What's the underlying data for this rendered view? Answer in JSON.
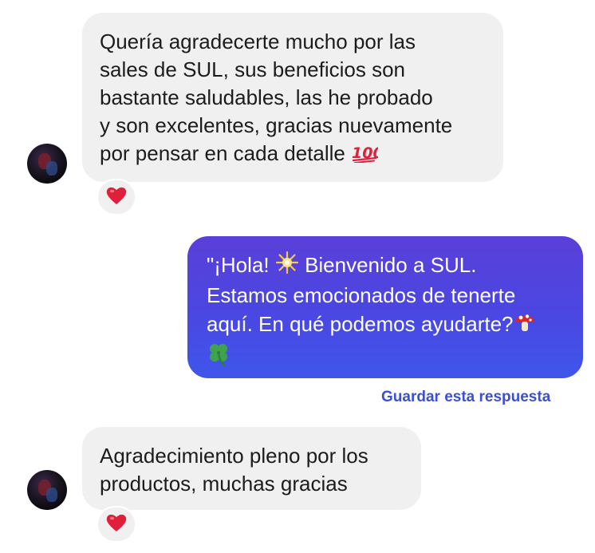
{
  "conversation": {
    "messages": [
      {
        "direction": "incoming",
        "lines": [
          "Quería agradecerte mucho por las",
          "sales de SUL, sus beneficios son",
          "bastante saludables, las he probado",
          "y son excelentes, gracias nuevamente",
          "por pensar en cada detalle"
        ],
        "trailing_emoji": "hundred-points-icon",
        "reaction": "heart-icon"
      },
      {
        "direction": "outgoing",
        "lines": [
          "\"¡Hola!",
          "Bienvenido a SUL.",
          "Estamos emocionados de tenerte",
          "aquí. En qué podemos ayudarte?"
        ],
        "emojis": [
          "sparkle-star-icon",
          "mushroom-icon",
          "four-leaf-clover-icon"
        ]
      },
      {
        "direction": "incoming",
        "lines": [
          "Agradecimiento pleno por los",
          "productos, muchas gracias"
        ],
        "reaction": "heart-icon"
      }
    ],
    "save_reply_label": "Guardar esta respuesta"
  },
  "colors": {
    "incoming_bubble": "#f0f0f0",
    "outgoing_bubble_top": "#5a3fd8",
    "outgoing_bubble_bottom": "#3f56ea",
    "save_link": "#3b4fd6",
    "heart": "#e0203a"
  }
}
